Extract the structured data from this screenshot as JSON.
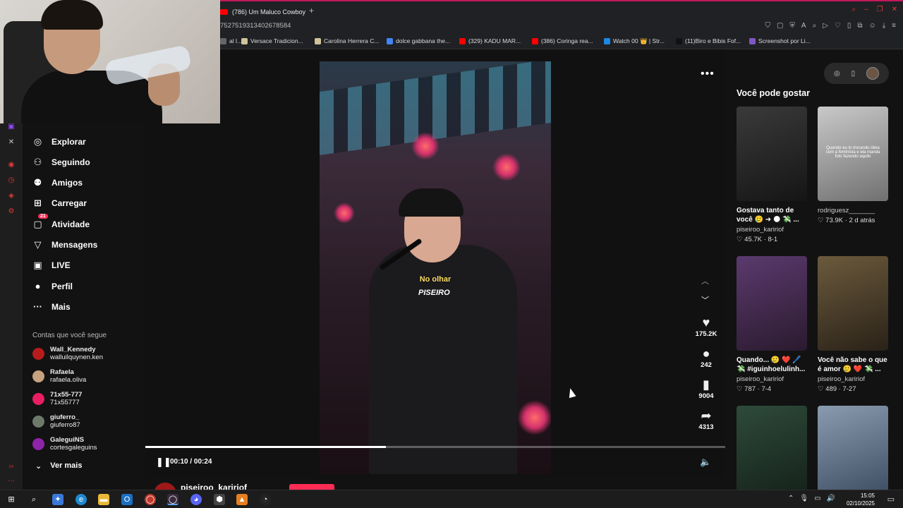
{
  "browser": {
    "active_tab": "(786) Um Maluco Cowboy",
    "new_tab_symbol": "+",
    "url_fragment": "7527519313402678584",
    "bookmarks": [
      {
        "label": "al l...",
        "color": "#666"
      },
      {
        "label": "Versace Tradicion...",
        "color": "#cfc39a"
      },
      {
        "label": "Carolina Herrera C...",
        "color": "#cfc39a"
      },
      {
        "label": "dolce gabbana the...",
        "color": "#4285f4"
      },
      {
        "label": "(329) KADU MAR...",
        "color": "#ff0000"
      },
      {
        "label": "(386) Coringa rea...",
        "color": "#ff0000"
      },
      {
        "label": "Watch 00 👑 | Str...",
        "color": "#1e88e5"
      },
      {
        "label": "(11)Biro e Bibis Fof...",
        "color": "#111111"
      },
      {
        "label": "Screenshot por Li...",
        "color": "#7e57c2"
      }
    ]
  },
  "sidebar": {
    "nav": [
      {
        "label": "Explorar",
        "icon": "compass-icon",
        "glyph": "◎"
      },
      {
        "label": "Seguindo",
        "icon": "following-icon",
        "glyph": "⚇"
      },
      {
        "label": "Amigos",
        "icon": "friends-icon",
        "glyph": "⚉"
      },
      {
        "label": "Carregar",
        "icon": "upload-icon",
        "glyph": "⊞"
      },
      {
        "label": "Atividade",
        "icon": "activity-icon",
        "glyph": "▢",
        "badge": "21"
      },
      {
        "label": "Mensagens",
        "icon": "messages-icon",
        "glyph": "▽"
      },
      {
        "label": "LIVE",
        "icon": "live-icon",
        "glyph": "▣"
      },
      {
        "label": "Perfil",
        "icon": "profile-icon",
        "glyph": "●"
      },
      {
        "label": "Mais",
        "icon": "more-icon",
        "glyph": "···"
      }
    ],
    "following_title": "Contas que você segue",
    "accounts": [
      {
        "name": "Wall_Kennedy",
        "handle": "walluilquynen.ken",
        "color": "#b71c1c"
      },
      {
        "name": "Rafaela",
        "handle": "rafaela.oliva",
        "color": "#c7a27e"
      },
      {
        "name": "71x55-777",
        "handle": "71x55777",
        "color": "#e91e63"
      },
      {
        "name": "giuferro_",
        "handle": "giuferro87",
        "color": "#6d7a6a"
      },
      {
        "name": "GaleguiNS",
        "handle": "cortesgaleguins",
        "color": "#8e24aa"
      }
    ],
    "see_more": "Ver mais"
  },
  "video": {
    "caption": "No olhar",
    "shirt_logo": "PISEIRO",
    "likes": "175.2K",
    "comments": "242",
    "saves": "9004",
    "shares": "4313",
    "time": "00:10 / 00:24",
    "progress": 0.415,
    "author": "piseiroo_kaririof"
  },
  "suggestions": {
    "title": "Você pode gostar",
    "cards": [
      {
        "desc": "Gostava tanto de você 🥲 ➜ 🌑 💸 ...",
        "author": "piseiroo_kaririof",
        "likes": "45.7K",
        "date": "8-1",
        "bg": "linear-gradient(160deg,#3a3a3a,#151515)",
        "thumb_text": "",
        "col": 0,
        "row": 0
      },
      {
        "desc": "",
        "author": "rodriguesz_______",
        "likes": "73.9K",
        "date": "2 d atrás",
        "bg": "linear-gradient(160deg,#c9c9c9,#707070)",
        "thumb_text": "Quando eu to trocando ideia com a feminista e ela manda foto fazendo aquilo",
        "col": 1,
        "row": 0
      },
      {
        "desc": "Quando... 🥲 ❤️ 🖊️ 💸 #iguinhoelulinh...",
        "author": "piseiroo_kaririof",
        "likes": "787",
        "date": "7-4",
        "bg": "linear-gradient(160deg,#5b3a6e,#2a1a2e)",
        "thumb_text": "",
        "col": 0,
        "row": 1
      },
      {
        "desc": "Você não sabe o que é amor 🥲 ❤️ 💸 ...",
        "author": "piseiroo_kaririof",
        "likes": "489",
        "date": "7-27",
        "bg": "linear-gradient(160deg,#6b5a3c,#2a2218)",
        "thumb_text": "",
        "col": 1,
        "row": 1
      },
      {
        "desc": "",
        "author": "",
        "likes": "",
        "date": "",
        "bg": "linear-gradient(160deg,#2e4a3a,#142019)",
        "thumb_text": "",
        "col": 0,
        "row": 2
      },
      {
        "desc": "",
        "author": "",
        "likes": "",
        "date": "",
        "bg": "linear-gradient(160deg,#8a9bb0,#3a4a5e)",
        "thumb_text": "",
        "col": 1,
        "row": 2
      }
    ]
  },
  "taskbar": {
    "time": "15:05",
    "date": "02/10/2025"
  }
}
